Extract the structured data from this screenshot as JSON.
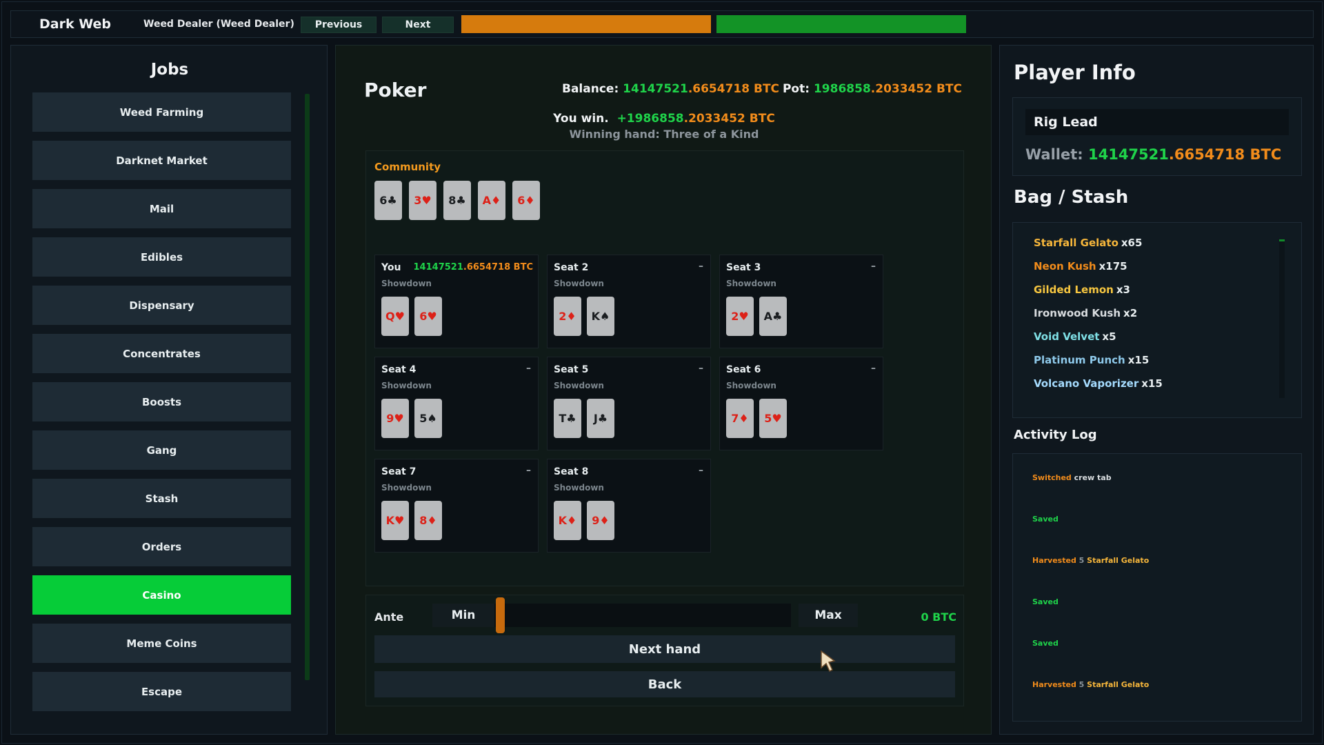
{
  "topbar": {
    "brand": "Dark Web",
    "crumb": "Weed Dealer (Weed Dealer)",
    "prev_label": "Previous",
    "next_label": "Next",
    "progress_orange": 1.0,
    "progress_green": 1.0,
    "colors": {
      "orange": "#d67b0d",
      "green": "#139326"
    }
  },
  "sidebar": {
    "title": "Jobs",
    "items": [
      {
        "label": "Weed Farming",
        "active": false
      },
      {
        "label": "Darknet Market",
        "active": false
      },
      {
        "label": "Mail",
        "active": false
      },
      {
        "label": "Edibles",
        "active": false
      },
      {
        "label": "Dispensary",
        "active": false
      },
      {
        "label": "Concentrates",
        "active": false
      },
      {
        "label": "Boosts",
        "active": false
      },
      {
        "label": "Gang",
        "active": false
      },
      {
        "label": "Stash",
        "active": false
      },
      {
        "label": "Orders",
        "active": false
      },
      {
        "label": "Casino",
        "active": true
      },
      {
        "label": "Meme Coins",
        "active": false
      },
      {
        "label": "Escape",
        "active": false
      }
    ],
    "active_color": "#06cc38"
  },
  "poker": {
    "title": "Poker",
    "balance_label": "Balance:",
    "balance_int": "14147521",
    "balance_frac": ".6654718 BTC",
    "pot_label": "Pot:",
    "pot_int": "1986858",
    "pot_frac": ".2033452 BTC",
    "win_prefix": "You win.",
    "win_int": "+1986858",
    "win_frac": ".2033452 BTC",
    "winning_hand": "Winning hand: Three of a Kind",
    "community_label": "Community",
    "community": [
      {
        "text": "6♣",
        "color": "black"
      },
      {
        "text": "3♥",
        "color": "red"
      },
      {
        "text": "8♣",
        "color": "black"
      },
      {
        "text": "A♦",
        "color": "red"
      },
      {
        "text": "6♦",
        "color": "red"
      }
    ],
    "seats": [
      {
        "name": "You",
        "amount_int": "14147521",
        "amount_frac": ".6654718 BTC",
        "status": "Showdown",
        "cards": [
          {
            "text": "Q♥",
            "color": "red"
          },
          {
            "text": "6♥",
            "color": "red"
          }
        ]
      },
      {
        "name": "Seat 2",
        "dash": "–",
        "status": "Showdown",
        "cards": [
          {
            "text": "2♦",
            "color": "red"
          },
          {
            "text": "K♠",
            "color": "black"
          }
        ]
      },
      {
        "name": "Seat 3",
        "dash": "–",
        "status": "Showdown",
        "cards": [
          {
            "text": "2♥",
            "color": "red"
          },
          {
            "text": "A♣",
            "color": "black"
          }
        ]
      },
      {
        "name": "Seat 4",
        "dash": "–",
        "status": "Showdown",
        "cards": [
          {
            "text": "9♥",
            "color": "red"
          },
          {
            "text": "5♠",
            "color": "black"
          }
        ]
      },
      {
        "name": "Seat 5",
        "dash": "–",
        "status": "Showdown",
        "cards": [
          {
            "text": "T♣",
            "color": "black"
          },
          {
            "text": "J♣",
            "color": "black"
          }
        ]
      },
      {
        "name": "Seat 6",
        "dash": "–",
        "status": "Showdown",
        "cards": [
          {
            "text": "7♦",
            "color": "red"
          },
          {
            "text": "5♥",
            "color": "red"
          }
        ]
      },
      {
        "name": "Seat 7",
        "dash": "–",
        "status": "Showdown",
        "cards": [
          {
            "text": "K♥",
            "color": "red"
          },
          {
            "text": "8♦",
            "color": "red"
          }
        ]
      },
      {
        "name": "Seat 8",
        "dash": "–",
        "status": "Showdown",
        "cards": [
          {
            "text": "K♦",
            "color": "red"
          },
          {
            "text": "9♦",
            "color": "red"
          }
        ]
      }
    ],
    "ante_label": "Ante",
    "min_label": "Min",
    "max_label": "Max",
    "ante_value": "0 BTC",
    "slider_fraction": 0.0,
    "next_hand_label": "Next hand",
    "back_label": "Back",
    "colors": {
      "green": "#1fd34a",
      "orange": "#f28c1b",
      "card_red": "#dc2118"
    }
  },
  "player": {
    "title": "Player Info",
    "rank": "Rig Lead",
    "wallet_label": "Wallet:",
    "wallet_int": "14147521",
    "wallet_frac": ".6654718 BTC"
  },
  "bag": {
    "title": "Bag / Stash",
    "items": [
      {
        "name": "Starfall Gelato",
        "qty": "x65",
        "color": "#f6b63b"
      },
      {
        "name": "Neon Kush",
        "qty": "x175",
        "color": "#f28c1b"
      },
      {
        "name": "Gilded Lemon",
        "qty": "x3",
        "color": "#f6c640"
      },
      {
        "name": "Ironwood Kush",
        "qty": "x2",
        "color": "#d9dde0"
      },
      {
        "name": "Void Velvet",
        "qty": "x5",
        "color": "#7fe0e6"
      },
      {
        "name": "Platinum Punch",
        "qty": "x15",
        "color": "#8ec9ea"
      },
      {
        "name": "Volcano Vaporizer",
        "qty": "x15",
        "color": "#a6dcff"
      }
    ]
  },
  "log": {
    "title": "Activity Log",
    "items": [
      {
        "parts": [
          {
            "t": "Switched ",
            "c": "#f28c1b"
          },
          {
            "t": "crew tab",
            "c": "#d9dde0"
          }
        ]
      },
      {
        "parts": [
          {
            "t": "Saved",
            "c": "#1fd34a"
          }
        ]
      },
      {
        "parts": [
          {
            "t": "Harvested ",
            "c": "#f28c1b"
          },
          {
            "t": "5 ",
            "c": "#8a949b"
          },
          {
            "t": "Starfall Gelato",
            "c": "#f6b63b"
          }
        ]
      },
      {
        "parts": [
          {
            "t": "Saved",
            "c": "#1fd34a"
          }
        ]
      },
      {
        "parts": [
          {
            "t": "Saved",
            "c": "#1fd34a"
          }
        ]
      },
      {
        "parts": [
          {
            "t": "Harvested ",
            "c": "#f28c1b"
          },
          {
            "t": "5 ",
            "c": "#8a949b"
          },
          {
            "t": "Starfall Gelato",
            "c": "#f6b63b"
          }
        ]
      }
    ]
  }
}
